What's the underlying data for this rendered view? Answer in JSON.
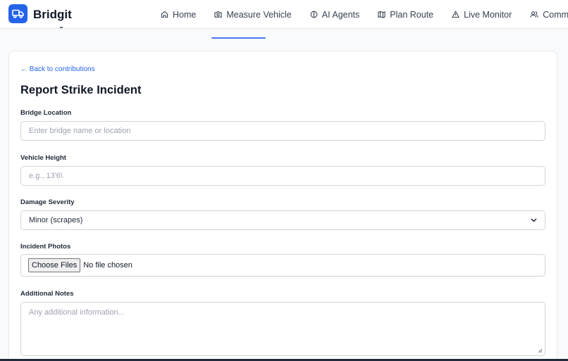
{
  "app": {
    "brand": "Bridgit"
  },
  "nav": {
    "items": [
      {
        "label": "Home",
        "icon": "home-icon"
      },
      {
        "label": "Measure Vehicle",
        "icon": "camera-icon"
      },
      {
        "label": "AI Agents",
        "icon": "brain-icon"
      },
      {
        "label": "Plan Route",
        "icon": "map-icon"
      },
      {
        "label": "Live Monitor",
        "icon": "warning-icon"
      },
      {
        "label": "Community",
        "icon": "users-icon"
      }
    ]
  },
  "form": {
    "back_link": "← Back to contributions",
    "title": "Report Strike Incident",
    "bridge_location": {
      "label": "Bridge Location",
      "placeholder": "Enter bridge name or location"
    },
    "vehicle_height": {
      "label": "Vehicle Height",
      "placeholder": "e.g., 13'6\\"
    },
    "damage_severity": {
      "label": "Damage Severity",
      "selected": "Minor (scrapes)"
    },
    "incident_photos": {
      "label": "Incident Photos",
      "button": "Choose Files",
      "status": "No file chosen"
    },
    "additional_notes": {
      "label": "Additional Notes",
      "placeholder": "Any additional information..."
    }
  },
  "colors": {
    "accent": "#2563eb",
    "border": "#d1d5db",
    "placeholder": "#9ca3af"
  }
}
